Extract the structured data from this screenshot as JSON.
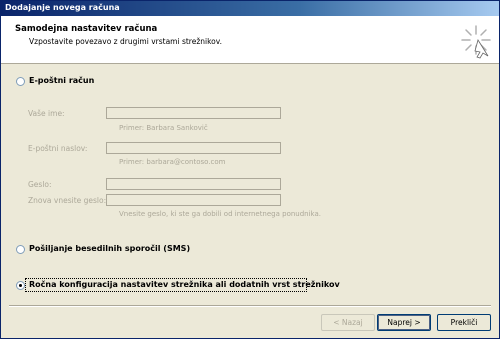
{
  "window": {
    "title": "Dodajanje novega računa"
  },
  "header": {
    "title": "Samodejna nastavitev računa",
    "subtitle": "Vzpostavite povezavo z drugimi vrstami strežnikov."
  },
  "options": {
    "email_account": {
      "label": "E-poštni račun",
      "selected": false
    },
    "sms": {
      "label": "Pošiljanje besedilnih sporočil (SMS)",
      "selected": false
    },
    "manual": {
      "label": "Ročna konfiguracija nastavitev strežnika ali dodatnih vrst strežnikov",
      "selected": true
    }
  },
  "fields": {
    "name": {
      "label": "Vaše ime:",
      "value": "",
      "hint": "Primer: Barbara Sankovič"
    },
    "email": {
      "label": "E-poštni naslov:",
      "value": "",
      "hint": "Primer: barbara@contoso.com"
    },
    "password": {
      "label": "Geslo:",
      "value": ""
    },
    "password_repeat": {
      "label": "Znova vnesite geslo:",
      "value": ""
    },
    "password_hint": "Vnesite geslo, ki ste ga dobili od internetnega ponudnika."
  },
  "buttons": {
    "back": "< Nazaj",
    "next": "Naprej >",
    "cancel": "Prekliči"
  },
  "icons": {
    "header_icon": "sparkle-icon"
  }
}
